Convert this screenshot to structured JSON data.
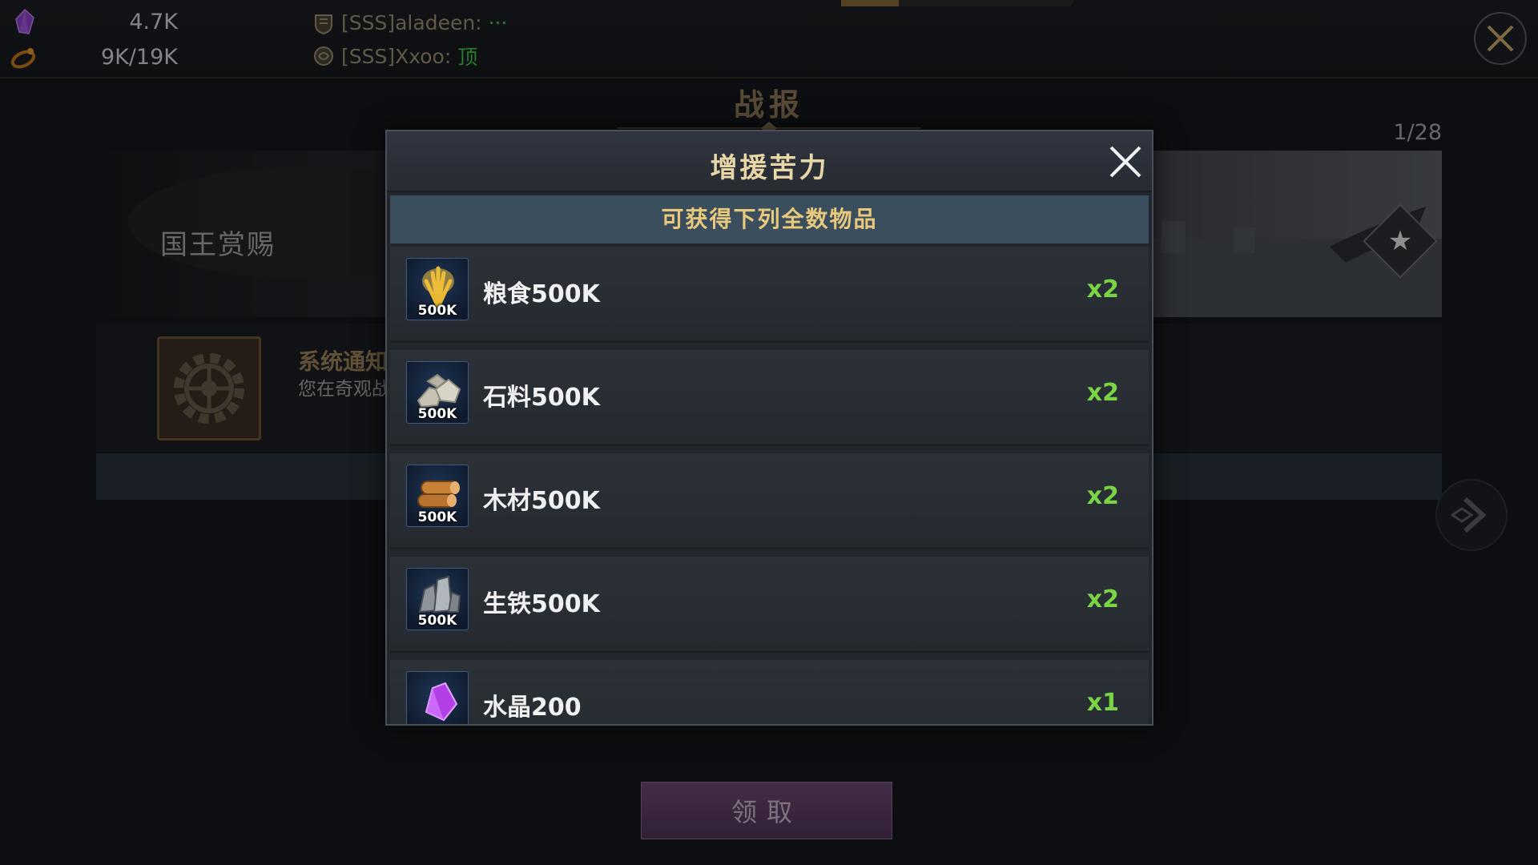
{
  "hud": {
    "resources": [
      {
        "icon": "crystal-icon",
        "value": "4.7K"
      },
      {
        "icon": "stamina-icon",
        "value": "9K/19K"
      }
    ],
    "chat": [
      {
        "sender": "[SSS]aladeen:",
        "message": "···"
      },
      {
        "sender": "[SSS]Xxoo:",
        "message": "顶"
      }
    ]
  },
  "background": {
    "title": "战报",
    "page_counter": "1/28",
    "banner_label": "国王赏赐",
    "notice_title": "系统通知",
    "notice_subtitle": "您在奇观战",
    "claim_button": "领取"
  },
  "modal": {
    "title": "增援苦力",
    "subtitle": "可获得下列全数物品",
    "items": [
      {
        "name": "粮食500K",
        "count": "x2",
        "icon": "grain-icon",
        "badge": "500K"
      },
      {
        "name": "石料500K",
        "count": "x2",
        "icon": "stone-icon",
        "badge": "500K"
      },
      {
        "name": "木材500K",
        "count": "x2",
        "icon": "wood-icon",
        "badge": "500K"
      },
      {
        "name": "生铁500K",
        "count": "x2",
        "icon": "iron-icon",
        "badge": "500K"
      },
      {
        "name": "水晶200",
        "count": "x1",
        "icon": "crystal-icon",
        "badge": ""
      }
    ]
  },
  "colors": {
    "accent_gold": "#e8c87a",
    "count_green": "#79d544",
    "chat_green": "#48c84a",
    "claim_purple": "#5f406a"
  }
}
